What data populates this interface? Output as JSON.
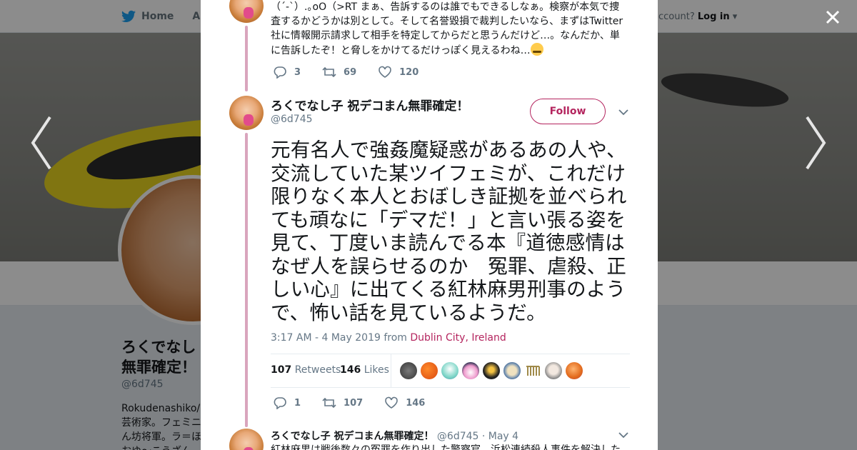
{
  "background": {
    "nav": {
      "home_label": "Home",
      "about_label": "Abo",
      "account_prompt": "ccount?",
      "login_label": "Log in"
    },
    "profile": {
      "name_line1": "ろくでなし",
      "name_line2": "無罪確定！",
      "handle": "@6d745",
      "bio_line1": "Rokudenashiko/ M",
      "bio_line2": "芸術家。フェミニ",
      "bio_line3": "ん坊将軍。ラ＝ほ",
      "bio_line4": "おゆ〜こうざん"
    }
  },
  "prev_tweet": {
    "text": "（´-`）.｡oO（>RT まぁ、告訴するのは誰でもできるしなぁ。検察が本気で捜査するかどうかは別として。そして名誉毀損で裁判したいなら、まずはTwitter社に情報開示請求して相手を特定してからだと思うんだけど…。なんだか、単に告訴したぞ！と脅しをかけてるだけっぽく見えるわね…",
    "replies": "3",
    "retweets": "69",
    "likes": "120"
  },
  "main_tweet": {
    "author_name": "ろくでなし子 祝デコまん無罪確定！",
    "handle": "@6d745",
    "follow_label": "Follow",
    "text": "元有名人で強姦魔疑惑があるあの人や、交流していた某ツイフェミが、これだけ限りなく本人とおぼしき証拠を並べられても頑なに「デマだ！」と言い張る姿を見て、丁度いま読んでる本『道徳感情はなぜ人を誤らせるのか　冤罪、虐殺、正しい心』に出てくる紅林麻男刑事のようで、怖い話を見ているようだ。",
    "timestamp": "3:17 AM - 4 May 2019 from ",
    "location": "Dublin City, Ireland",
    "retweet_count": "107",
    "retweet_label": "Retweets",
    "like_count": "146",
    "like_label": "Likes",
    "replies": "1",
    "retweets": "107",
    "likes": "146"
  },
  "reply_tweet": {
    "author_name": "ろくでなし子 祝デコまん無罪確定！",
    "handle_date": "@6d745 · May 4",
    "text": "紅林麻男は戦後数々の冤罪を作り出した警察官。浜松連続殺人事件を解決した"
  },
  "colors": {
    "accent": "#b4245e",
    "thread_line": "#d9a5bd",
    "text_secondary": "#657786"
  }
}
